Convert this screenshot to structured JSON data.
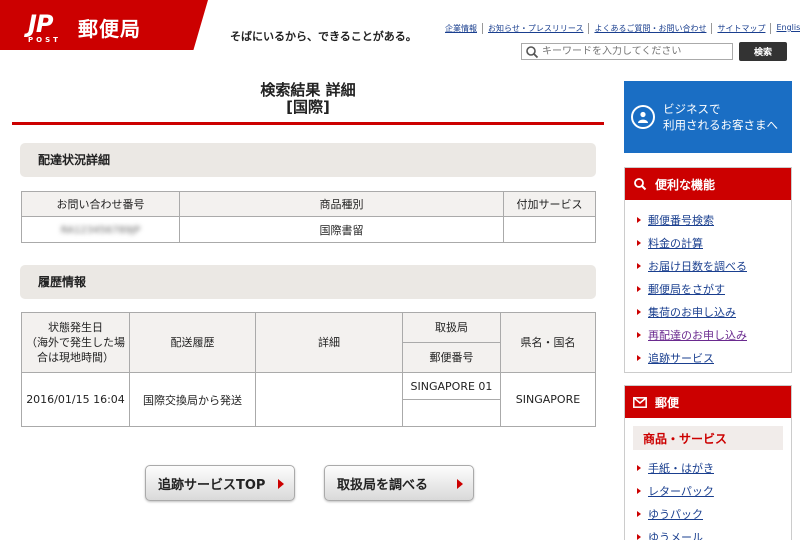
{
  "header": {
    "logo_mark": "JP",
    "logo_post": "POST",
    "logo_name": "郵便局",
    "tagline": "そばにいるから、できることがある。",
    "links": [
      "企業情報",
      "お知らせ・プレスリリース",
      "よくあるご質問・お問い合わせ",
      "サイトマップ",
      "English"
    ],
    "search_placeholder": "キーワードを入力してください",
    "search_button": "検索"
  },
  "main": {
    "title_line1": "検索結果 詳細",
    "title_line2": "[国際]",
    "section1_title": "配達状況詳細",
    "table1": {
      "headers": [
        "お問い合わせ番号",
        "商品種別",
        "付加サービス"
      ],
      "row": {
        "tracking_number": "RA123456789JP",
        "product_type": "国際書留",
        "extra_service": ""
      }
    },
    "section2_title": "履歴情報",
    "table2": {
      "header_date": "状態発生日（海外で発生した場合は現地時間）",
      "header_date_l1": "状態発生日",
      "header_date_l2": "（海外で発生した場",
      "header_date_l3": "合は現地時間）",
      "header_history": "配送履歴",
      "header_detail": "詳細",
      "header_office": "取扱局",
      "header_postal": "郵便番号",
      "header_region": "県名・国名",
      "row": {
        "date": "2016/01/15 16:04",
        "history": "国際交換局から発送",
        "detail": "",
        "office": "SINGAPORE 01",
        "postal": "",
        "region": "SINGAPORE"
      }
    },
    "buttons": {
      "tracking_top": "追跡サービスTOP",
      "find_office": "取扱局を調べる"
    }
  },
  "sidebar": {
    "business_line1": "ビジネスで",
    "business_line2": "利用されるお客さまへ",
    "useful_title": "便利な機能",
    "useful_items": [
      "郵便番号検索",
      "料金の計算",
      "お届け日数を調べる",
      "郵便局をさがす",
      "集荷のお申し込み",
      "再配達のお申し込み",
      "追跡サービス"
    ],
    "mail_title": "郵便",
    "mail_subhead": "商品・サービス",
    "mail_items": [
      "手紙・はがき",
      "レターパック",
      "ゆうパック",
      "ゆうメール"
    ]
  },
  "colors": {
    "brand_red": "#cc0000",
    "business_blue": "#1a6ec4",
    "link_blue": "#1a3f8f"
  }
}
